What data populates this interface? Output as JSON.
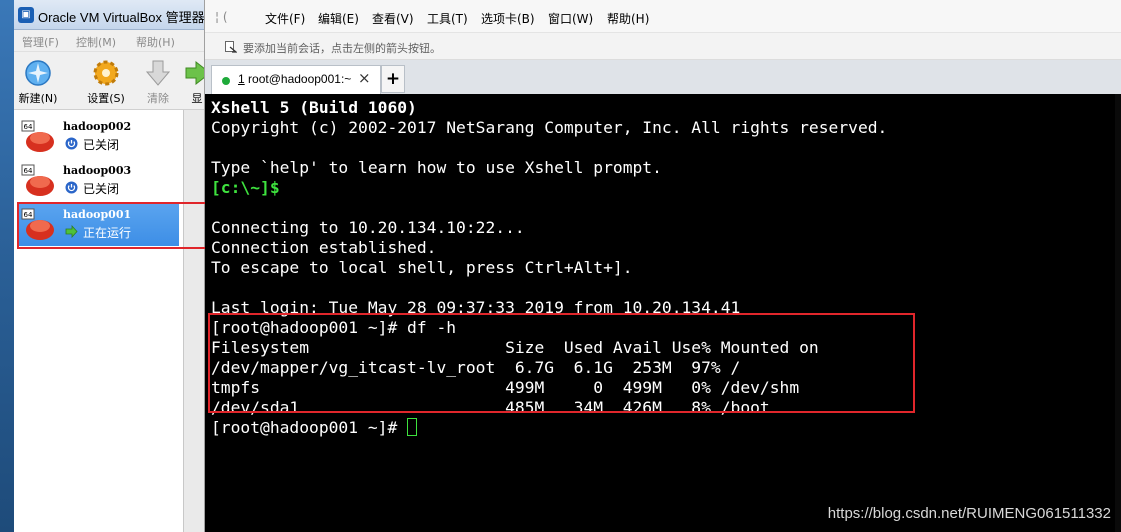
{
  "vbox": {
    "title": "Oracle VM VirtualBox 管理器",
    "menu": [
      "管理(F)",
      "控制(M)",
      "帮助(H)"
    ],
    "toolbar": {
      "new_label": "新建(N)",
      "settings_label": "设置(S)",
      "discard_label": "清除",
      "show_label": "显"
    },
    "vms": [
      {
        "name": "hadoop002",
        "status": "已关闭",
        "selected": false
      },
      {
        "name": "hadoop003",
        "status": "已关闭",
        "selected": false
      },
      {
        "name": "hadoop001",
        "status": "正在运行",
        "selected": true
      }
    ]
  },
  "xshell": {
    "menu": [
      "文件(F)",
      "编辑(E)",
      "查看(V)",
      "工具(T)",
      "选项卡(B)",
      "窗口(W)",
      "帮助(H)"
    ],
    "address_hint": "要添加当前会话，点击左侧的箭头按钮。",
    "tab": {
      "number": "1",
      "label": "root@hadoop001:~",
      "close": "×"
    },
    "add_tab": "+",
    "terminal": {
      "banner": "Xshell 5 (Build 1060)",
      "copyright": "Copyright (c) 2002-2017 NetSarang Computer, Inc. All rights reserved.",
      "help_line": "Type `help' to learn how to use Xshell prompt.",
      "local_prompt": "[c:\\~]$",
      "connecting": "Connecting to 10.20.134.10:22...",
      "established": "Connection established.",
      "escape_hint": "To escape to local shell, press Ctrl+Alt+].",
      "last_login": "Last login: Tue May 28 09:37:33 2019 from 10.20.134.41",
      "cmd_line": "[root@hadoop001 ~]# df -h",
      "df_header": "Filesystem                    Size  Used Avail Use% Mounted on",
      "df_rows": [
        "/dev/mapper/vg_itcast-lv_root  6.7G  6.1G  253M  97% /",
        "tmpfs                         499M     0  499M   0% /dev/shm",
        "/dev/sda1                     485M   34M  426M   8% /boot"
      ],
      "final_prompt": "[root@hadoop001 ~]# "
    }
  },
  "watermark": "https://blog.csdn.net/RUIMENG061511332",
  "colors": {
    "terminal_bg": "#000000",
    "prompt_green": "#3ee23e",
    "highlight_red": "#e0262b",
    "selection_blue": "#3d8ee6"
  }
}
